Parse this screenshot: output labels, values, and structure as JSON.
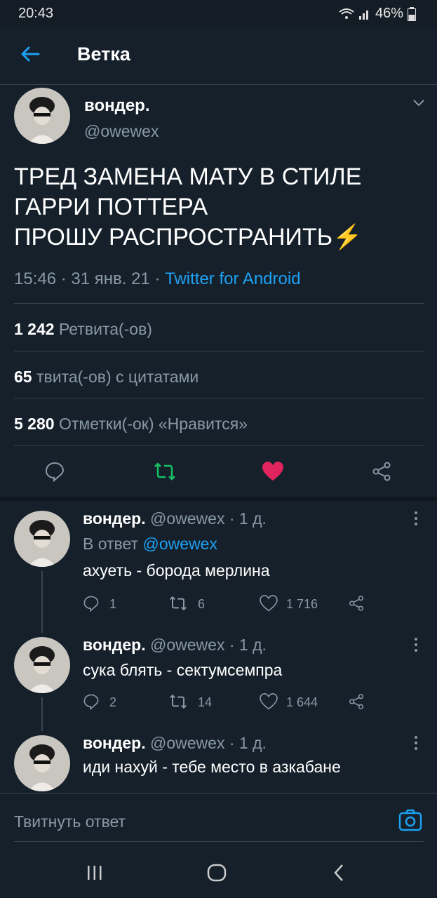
{
  "status_bar": {
    "time": "20:43",
    "battery": "46%"
  },
  "header": {
    "title": "Ветка"
  },
  "main_tweet": {
    "author_name": "вондер.",
    "author_handle": "@owewex",
    "text_lines": [
      "ТРЕД ЗАМЕНА МАТУ В СТИЛЕ",
      "ГАРРИ ПОТТЕРА",
      "ПРОШУ РАСПРОСТРАНИТЬ"
    ],
    "emoji": "⚡",
    "time": "15:46 · 31 янв. 21 ·",
    "source": "Twitter for Android",
    "stats": [
      {
        "count": "1 242",
        "label": "Ретвита(-ов)"
      },
      {
        "count": "65",
        "label": "твита(-ов) с цитатами"
      },
      {
        "count": "5 280",
        "label": "Отметки(-ок) «Нравится»"
      }
    ]
  },
  "replies": [
    {
      "name": "вондер.",
      "meta": "@owewex · 1 д.",
      "reply_to_prefix": "В ответ",
      "reply_to_handle": "@owewex",
      "text": "ахуеть - борода мерлина",
      "comments": "1",
      "retweets": "6",
      "likes": "1 716"
    },
    {
      "name": "вондер.",
      "meta": "@owewex · 1 д.",
      "text": "сука блять - сектумсемпра",
      "comments": "2",
      "retweets": "14",
      "likes": "1 644"
    },
    {
      "name": "вондер.",
      "meta": "@owewex · 1 д.",
      "text": "иди нахуй - тебе место в азкабане"
    }
  ],
  "compose": {
    "placeholder": "Твитнуть ответ"
  },
  "colors": {
    "background": "#15202b",
    "accent": "#1da1f2",
    "like": "#e0245e",
    "retweet": "#17bf63",
    "muted": "#8899a6"
  }
}
